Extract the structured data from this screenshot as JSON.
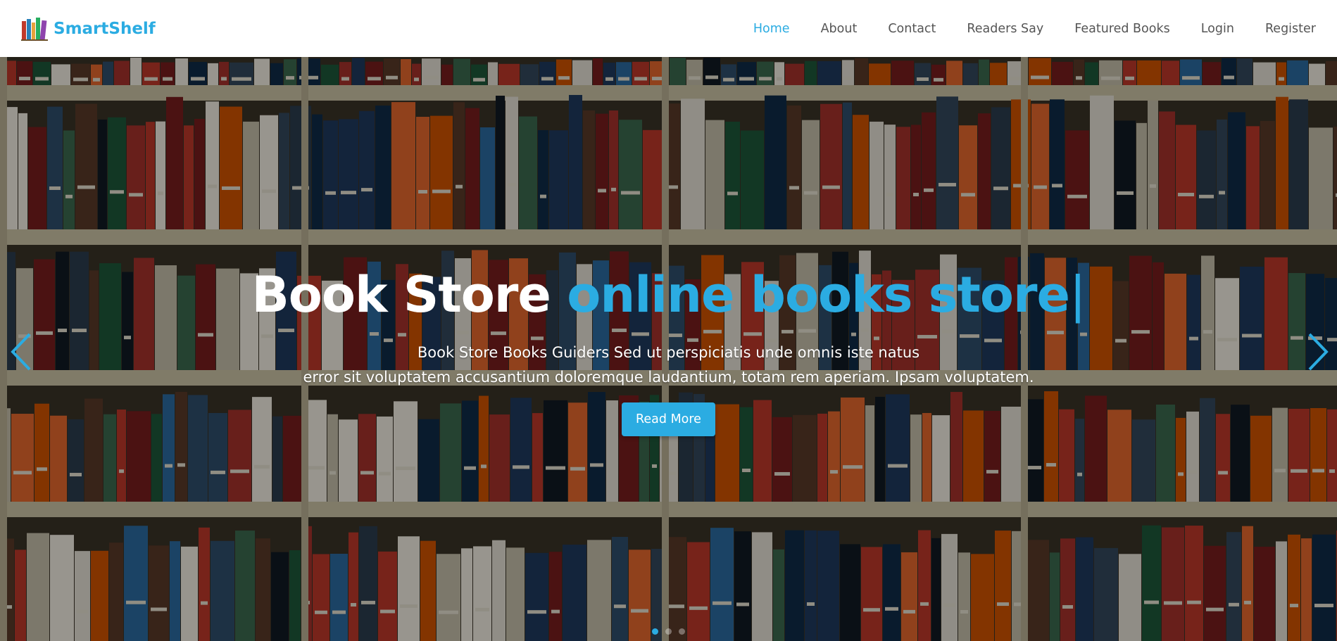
{
  "brand": {
    "name": "SmartShelf",
    "logo_icon": "books-logo-icon"
  },
  "nav": {
    "items": [
      {
        "label": "Home",
        "active": true
      },
      {
        "label": "About",
        "active": false
      },
      {
        "label": "Contact",
        "active": false
      },
      {
        "label": "Readers Say",
        "active": false
      },
      {
        "label": "Featured Books",
        "active": false
      },
      {
        "label": "Login",
        "active": false
      },
      {
        "label": "Register",
        "active": false
      }
    ]
  },
  "hero": {
    "title_static": "Book Store",
    "title_typed": "online books store",
    "caret": "|",
    "subtitle_line1": "Book Store Books Guiders Sed ut perspiciatis unde omnis iste natus",
    "subtitle_line2": "error sit voluptatem accusantium doloremque laudantium, totam rem aperiam. Ipsam voluptatem.",
    "button_label": "Read More",
    "prev_icon": "chevron-left-icon",
    "next_icon": "chevron-right-icon",
    "slides": 3,
    "active_slide": 1
  },
  "colors": {
    "accent": "#2bace2",
    "nav_text": "#555555",
    "hero_text": "#ffffff",
    "overlay": "rgba(0,0,0,0.38)"
  }
}
